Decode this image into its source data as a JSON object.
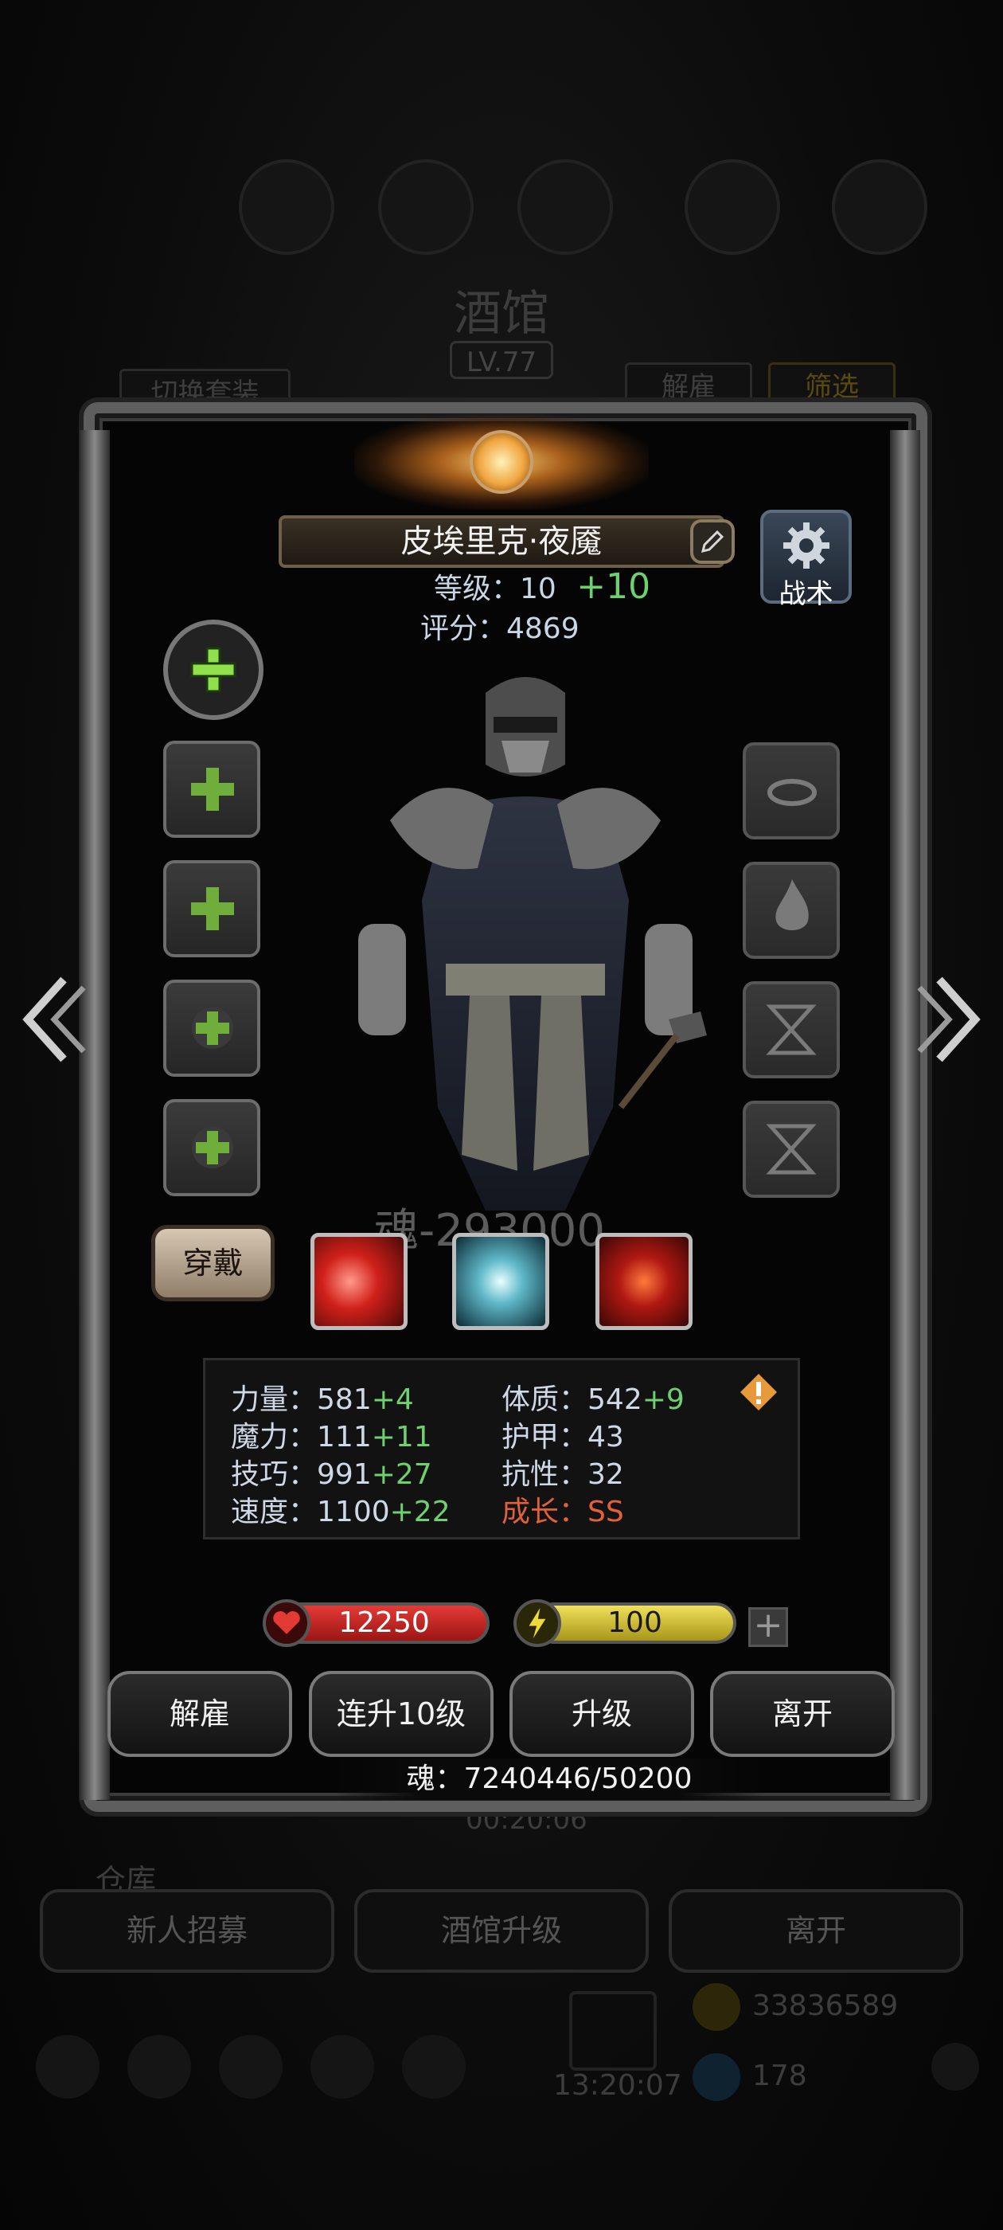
{
  "background": {
    "title": "酒馆",
    "level": "LV.77",
    "switch_outfit": "切换套装",
    "dismiss_tab": "解雇",
    "filter_tab": "筛选",
    "timer": "00:20:06",
    "section_label": "仓库",
    "bottom_buttons": [
      "新人招募",
      "酒馆升级",
      "离开"
    ],
    "gold": "33836589",
    "gems": "178",
    "clock": "13:20:07"
  },
  "hero": {
    "name": "皮埃里克·夜魇",
    "level_label": "等级：10",
    "level_bonus": "+10",
    "score_label": "评分：4869",
    "tactics_label": "战术",
    "soul_cost": "魂-293000",
    "wear_label": "穿戴"
  },
  "stats": {
    "strength": {
      "label": "力量：",
      "value": "581",
      "bonus": "+4"
    },
    "magic": {
      "label": "魔力：",
      "value": "111",
      "bonus": "+11"
    },
    "skill": {
      "label": "技巧：",
      "value": "991",
      "bonus": "+27"
    },
    "speed": {
      "label": "速度：",
      "value": "1100",
      "bonus": "+22"
    },
    "constitution": {
      "label": "体质：",
      "value": "542",
      "bonus": "+9"
    },
    "armor": {
      "label": "护甲：",
      "value": "43"
    },
    "resistance": {
      "label": "抗性：",
      "value": "32"
    },
    "growth": {
      "label": "成长：",
      "value": "SS"
    }
  },
  "bars": {
    "hp": "12250",
    "energy": "100"
  },
  "actions": {
    "dismiss": "解雇",
    "level_up_10": "连升10级",
    "level_up": "升级",
    "leave": "离开"
  },
  "soul_total": "魂：7240446/50200",
  "colors": {
    "bonus_green": "#6ed06e",
    "growth_red": "#e0613c",
    "hp_red": "#c9201f",
    "energy_yellow": "#d7c21d"
  }
}
